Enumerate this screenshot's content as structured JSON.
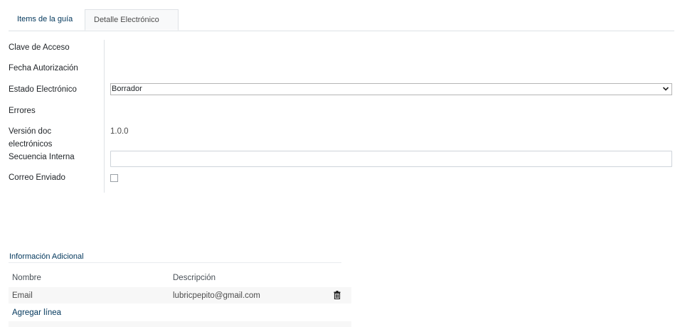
{
  "tabs": [
    {
      "label": "Items de la guía",
      "active": false
    },
    {
      "label": "Detalle Electrónico",
      "active": true
    }
  ],
  "form": {
    "access_key": {
      "label": "Clave de Acceso",
      "value": ""
    },
    "auth_date": {
      "label": "Fecha Autorización",
      "value": ""
    },
    "electronic_state": {
      "label": "Estado Electrónico",
      "value": "Borrador"
    },
    "errors": {
      "label": "Errores",
      "value": ""
    },
    "doc_version": {
      "label_line1": "Versión doc",
      "label_line2": "electrónicos",
      "value": "1.0.0"
    },
    "internal_sequence": {
      "label": "Secuencia Interna",
      "value": ""
    },
    "mail_sent": {
      "label": "Correo Enviado",
      "checked": false
    }
  },
  "additional_info": {
    "title": "Información Adicional",
    "columns": [
      "Nombre",
      "Descripción"
    ],
    "rows": [
      {
        "name": "Email",
        "description": "lubricpepito@gmail.com"
      }
    ],
    "add_line_label": "Agregar línea"
  },
  "icons": {
    "select_arrow": "chevron-down-icon",
    "row_delete": "trash-icon"
  },
  "colors": {
    "link": "#01365b",
    "border": "#dee2e6",
    "row_bg": "#f7f7f7"
  }
}
